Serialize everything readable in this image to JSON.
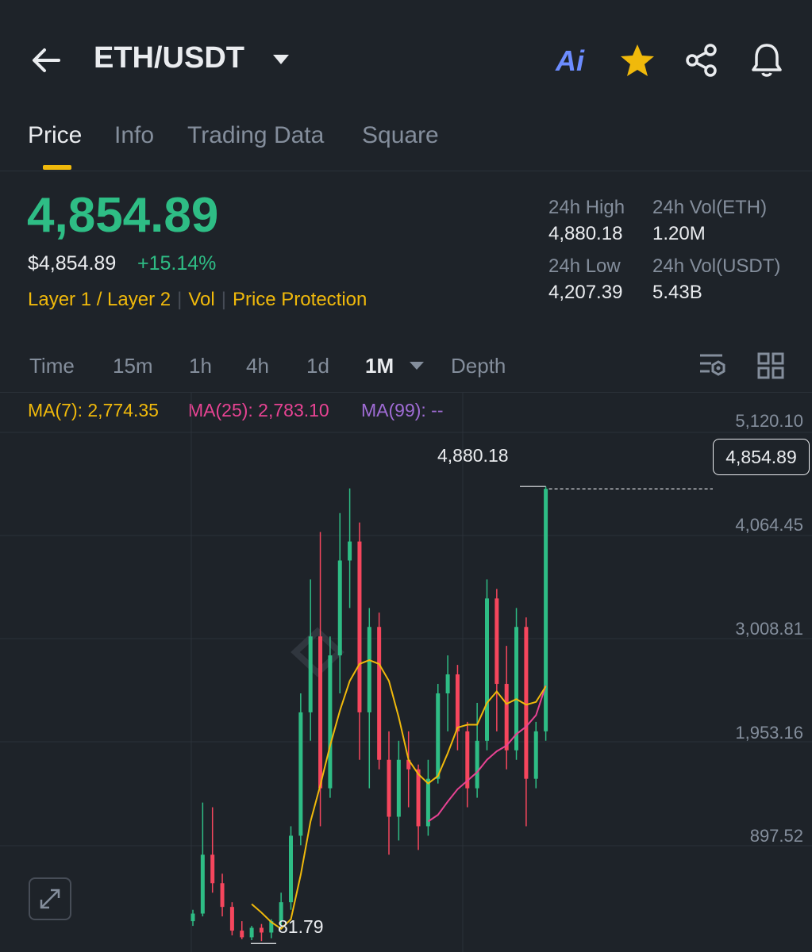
{
  "header": {
    "title": "ETH/USDT",
    "ai_label": "Ai"
  },
  "tabs": [
    {
      "label": "Price",
      "active": true
    },
    {
      "label": "Info"
    },
    {
      "label": "Trading Data"
    },
    {
      "label": "Square"
    }
  ],
  "ticker": {
    "last_price": "4,854.89",
    "usd_price": "$4,854.89",
    "change_pct": "+15.14%",
    "tags": [
      "Layer 1 / Layer 2",
      "Vol",
      "Price Protection"
    ],
    "stats": {
      "high_label": "24h High",
      "high_value": "4,880.18",
      "low_label": "24h Low",
      "low_value": "4,207.39",
      "vol_eth_label": "24h Vol(ETH)",
      "vol_eth_value": "1.20M",
      "vol_usdt_label": "24h Vol(USDT)",
      "vol_usdt_value": "5.43B"
    }
  },
  "intervals": [
    "Time",
    "15m",
    "1h",
    "4h",
    "1d",
    "1M",
    "Depth"
  ],
  "selected_interval": "1M",
  "indicators": {
    "ma7": "MA(7): 2,774.35",
    "ma25": "MA(25): 2,783.10",
    "ma99": "MA(99): --"
  },
  "colors": {
    "up": "#2ebd85",
    "down": "#f6465d",
    "accent": "#f0b90b",
    "ma7": "#f0b90b",
    "ma25": "#e84393",
    "ma99": "#a06cd5",
    "bg": "#1e2329"
  },
  "chart_data": {
    "type": "candlestick",
    "y_ticks": [
      "5,120.10",
      "4,064.45",
      "3,008.81",
      "1,953.16",
      "897.52"
    ],
    "ylim": [
      0,
      5450
    ],
    "current_price": "4,854.89",
    "current_value": 4854.89,
    "high_label": "4,880.18",
    "high_value": 4880.18,
    "low_label": "81.79",
    "low_value": 81.79,
    "ohlc": [
      [
        300,
        420,
        250,
        380
      ],
      [
        380,
        1550,
        350,
        1000
      ],
      [
        1000,
        1500,
        600,
        700
      ],
      [
        700,
        800,
        350,
        450
      ],
      [
        450,
        500,
        150,
        200
      ],
      [
        200,
        300,
        110,
        130
      ],
      [
        130,
        250,
        100,
        230
      ],
      [
        230,
        270,
        90,
        180
      ],
      [
        180,
        320,
        120,
        300
      ],
      [
        300,
        600,
        250,
        500
      ],
      [
        500,
        1300,
        420,
        1200
      ],
      [
        1200,
        2700,
        1100,
        2500
      ],
      [
        2500,
        3900,
        2200,
        3300
      ],
      [
        3300,
        4400,
        1300,
        1700
      ],
      [
        1700,
        3300,
        1600,
        3100
      ],
      [
        3100,
        4600,
        2700,
        4100
      ],
      [
        4100,
        4860,
        3600,
        4300
      ],
      [
        4300,
        4500,
        2000,
        2500
      ],
      [
        2500,
        3600,
        1700,
        3400
      ],
      [
        3400,
        3550,
        1900,
        2000
      ],
      [
        2000,
        2300,
        1000,
        1400
      ],
      [
        1400,
        2200,
        1150,
        2000
      ],
      [
        2000,
        2300,
        1500,
        1900
      ],
      [
        1900,
        1950,
        1050,
        1300
      ],
      [
        1300,
        2000,
        1200,
        1800
      ],
      [
        1800,
        2800,
        1750,
        2700
      ],
      [
        2700,
        3100,
        2300,
        2900
      ],
      [
        2900,
        3000,
        2100,
        2300
      ],
      [
        2300,
        2400,
        1500,
        1700
      ],
      [
        1700,
        2600,
        1600,
        2200
      ],
      [
        2200,
        3900,
        2100,
        3700
      ],
      [
        3700,
        3800,
        2300,
        2800
      ],
      [
        2800,
        3200,
        1900,
        2100
      ],
      [
        2100,
        3600,
        2000,
        3400
      ],
      [
        3400,
        3500,
        1300,
        1800
      ],
      [
        1800,
        2400,
        1700,
        2300
      ],
      [
        2300,
        4880,
        2200,
        4855
      ]
    ],
    "ma7": [
      null,
      null,
      null,
      null,
      null,
      null,
      480,
      390,
      290,
      220,
      320,
      790,
      1350,
      1730,
      2150,
      2520,
      2830,
      3010,
      3050,
      3010,
      2830,
      2450,
      2000,
      1850,
      1750,
      1830,
      2070,
      2340,
      2370,
      2370,
      2600,
      2720,
      2590,
      2640,
      2580,
      2610,
      2774
    ],
    "ma25": [
      null,
      null,
      null,
      null,
      null,
      null,
      null,
      null,
      null,
      null,
      null,
      null,
      null,
      null,
      null,
      null,
      null,
      null,
      null,
      null,
      null,
      null,
      null,
      null,
      1350,
      1420,
      1560,
      1690,
      1780,
      1870,
      2000,
      2090,
      2150,
      2270,
      2350,
      2470,
      2783
    ]
  }
}
